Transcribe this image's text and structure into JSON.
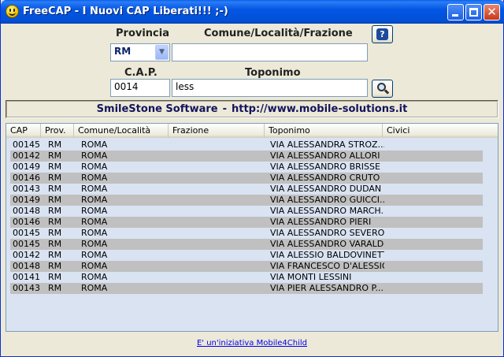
{
  "window": {
    "title": "FreeCAP - I Nuovi CAP Liberati!!! ;-)",
    "icon": "smiley-icon"
  },
  "form": {
    "provincia_label": "Provincia",
    "provincia_value": "RM",
    "comune_label": "Comune/Località/Frazione",
    "comune_value": "",
    "cap_label": "C.A.P.",
    "cap_value": "0014",
    "toponimo_label": "Toponimo",
    "toponimo_value": "less",
    "help_icon": "help-book-icon",
    "search_icon": "magnifier-icon"
  },
  "banner": {
    "company": "SmileStone Software",
    "separator": "-",
    "url": "http://www.mobile-solutions.it"
  },
  "table": {
    "columns": [
      "CAP",
      "Prov.",
      "Comune/Località",
      "Frazione",
      "Toponimo",
      "Civici"
    ],
    "rows": [
      [
        "00145",
        "RM",
        "ROMA",
        "",
        "VIA ALESSANDRA STROZ...",
        ""
      ],
      [
        "00142",
        "RM",
        "ROMA",
        "",
        "VIA ALESSANDRO ALLORI",
        ""
      ],
      [
        "00149",
        "RM",
        "ROMA",
        "",
        "VIA ALESSANDRO BRISSE",
        ""
      ],
      [
        "00146",
        "RM",
        "ROMA",
        "",
        "VIA ALESSANDRO CRUTO",
        ""
      ],
      [
        "00143",
        "RM",
        "ROMA",
        "",
        "VIA ALESSANDRO DUDAN",
        ""
      ],
      [
        "00149",
        "RM",
        "ROMA",
        "",
        "VIA ALESSANDRO GUICCI...",
        ""
      ],
      [
        "00148",
        "RM",
        "ROMA",
        "",
        "VIA ALESSANDRO MARCH...",
        ""
      ],
      [
        "00146",
        "RM",
        "ROMA",
        "",
        "VIA ALESSANDRO PIERI",
        ""
      ],
      [
        "00145",
        "RM",
        "ROMA",
        "",
        "VIA ALESSANDRO SEVERO",
        ""
      ],
      [
        "00145",
        "RM",
        "ROMA",
        "",
        "VIA ALESSANDRO VARALDO",
        ""
      ],
      [
        "00142",
        "RM",
        "ROMA",
        "",
        "VIA ALESSIO BALDOVINETTI",
        ""
      ],
      [
        "00148",
        "RM",
        "ROMA",
        "",
        "VIA FRANCESCO D'ALESSIO",
        ""
      ],
      [
        "00141",
        "RM",
        "ROMA",
        "",
        "VIA MONTI LESSINI",
        ""
      ],
      [
        "00143",
        "RM",
        "ROMA",
        "",
        "VIA PIER ALESSANDRO P...",
        ""
      ]
    ]
  },
  "footer": {
    "link_text": "E' un'iniziativa Mobile4Child"
  },
  "colors": {
    "titlebar": "#0356e3",
    "list_background": "#d9e3f2",
    "alt_row": "#c0c0c0",
    "banner_text": "#13135e"
  }
}
